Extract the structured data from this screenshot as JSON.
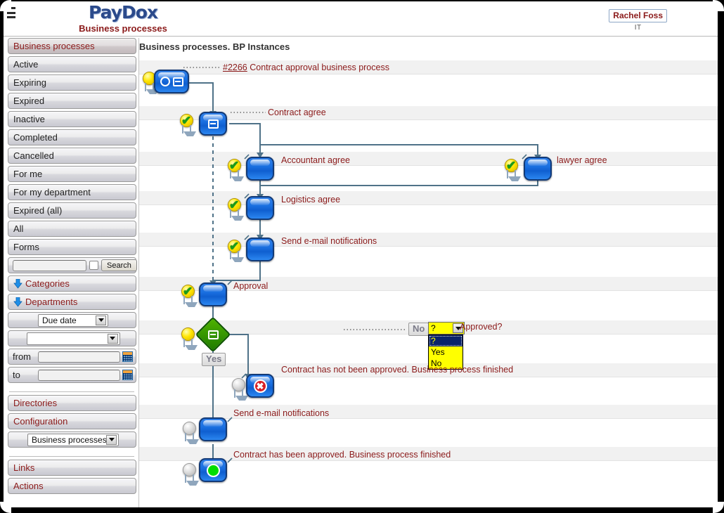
{
  "header": {
    "menu_icon": "hamburger-icon",
    "logo_text": "PayDox",
    "subtitle": "Business processes",
    "user_name": "Rachel Foss",
    "user_department": "IT"
  },
  "sidebar": {
    "items": [
      {
        "label": "Business processes",
        "selected": true
      },
      {
        "label": "Active",
        "selected": false
      },
      {
        "label": "Expiring",
        "selected": false
      },
      {
        "label": "Expired",
        "selected": false
      },
      {
        "label": "Inactive",
        "selected": false
      },
      {
        "label": "Completed",
        "selected": false
      },
      {
        "label": "Cancelled",
        "selected": false
      },
      {
        "label": "For me",
        "selected": false
      },
      {
        "label": "For my department",
        "selected": false
      },
      {
        "label": "Expired (all)",
        "selected": false
      },
      {
        "label": "All",
        "selected": false
      },
      {
        "label": "Forms",
        "selected": false
      }
    ],
    "search": {
      "value": "",
      "placeholder": "",
      "checkbox_checked": false,
      "button_label": "Search"
    },
    "categories_label": "Categories",
    "departments_label": "Departments",
    "date_field_select": {
      "value": "Due date",
      "options": [
        "Due date"
      ]
    },
    "secondary_select": {
      "value": "",
      "options": []
    },
    "from_label": "from",
    "from_value": "",
    "to_label": "to",
    "to_value": "",
    "directories_label": "Directories",
    "configuration_label": "Configuration",
    "module_select": {
      "value": "Business processes",
      "options": [
        "Business processes"
      ]
    },
    "links_label": "Links",
    "actions_label": "Actions"
  },
  "main": {
    "page_title": "Business processes. BP Instances",
    "process": {
      "id_link": "#2266",
      "id_title": "Contract approval business process"
    },
    "nodes": [
      {
        "id": "n0",
        "label": "Contract approval business process",
        "label_prefix": "#2266",
        "status": "pending",
        "icon": "start-collapse-icon"
      },
      {
        "id": "n1",
        "label": "Contract agree",
        "status": "done",
        "icon": "collapse-icon"
      },
      {
        "id": "n2",
        "label": "Accountant agree",
        "status": "done",
        "icon": "task-icon"
      },
      {
        "id": "n3",
        "label": "lawyer agree",
        "status": "done",
        "icon": "task-icon"
      },
      {
        "id": "n4",
        "label": "Logistics agree",
        "status": "done",
        "icon": "task-icon"
      },
      {
        "id": "n5",
        "label": "Send e-mail notifications",
        "status": "done",
        "icon": "task-icon"
      },
      {
        "id": "n6",
        "label": "Approval",
        "status": "done",
        "icon": "task-icon"
      },
      {
        "id": "n7",
        "label": "Approved?",
        "status": "pending",
        "icon": "decision-icon"
      },
      {
        "id": "n8",
        "label": "Contract has not been approved. Business process finished",
        "status": "inactive",
        "icon": "end-error-icon"
      },
      {
        "id": "n9",
        "label": "Send e-mail notifications",
        "status": "inactive",
        "icon": "task-icon"
      },
      {
        "id": "n10",
        "label": "Contract has been approved. Business process finished",
        "status": "inactive",
        "icon": "end-success-icon"
      }
    ],
    "flags": {
      "no_label": "No",
      "yes_label": "Yes"
    },
    "approval_select": {
      "value": "?",
      "open": true,
      "options": [
        "?",
        "Yes",
        "No"
      ],
      "highlighted": "?"
    }
  },
  "colors": {
    "accent_red": "#8b1a1a",
    "logo_blue": "#2b4a8b",
    "node_blue": "#1a6fe0",
    "decision_green": "#3a9c00",
    "select_yellow": "#ffff00",
    "band_gray": "#f1f1f1"
  }
}
